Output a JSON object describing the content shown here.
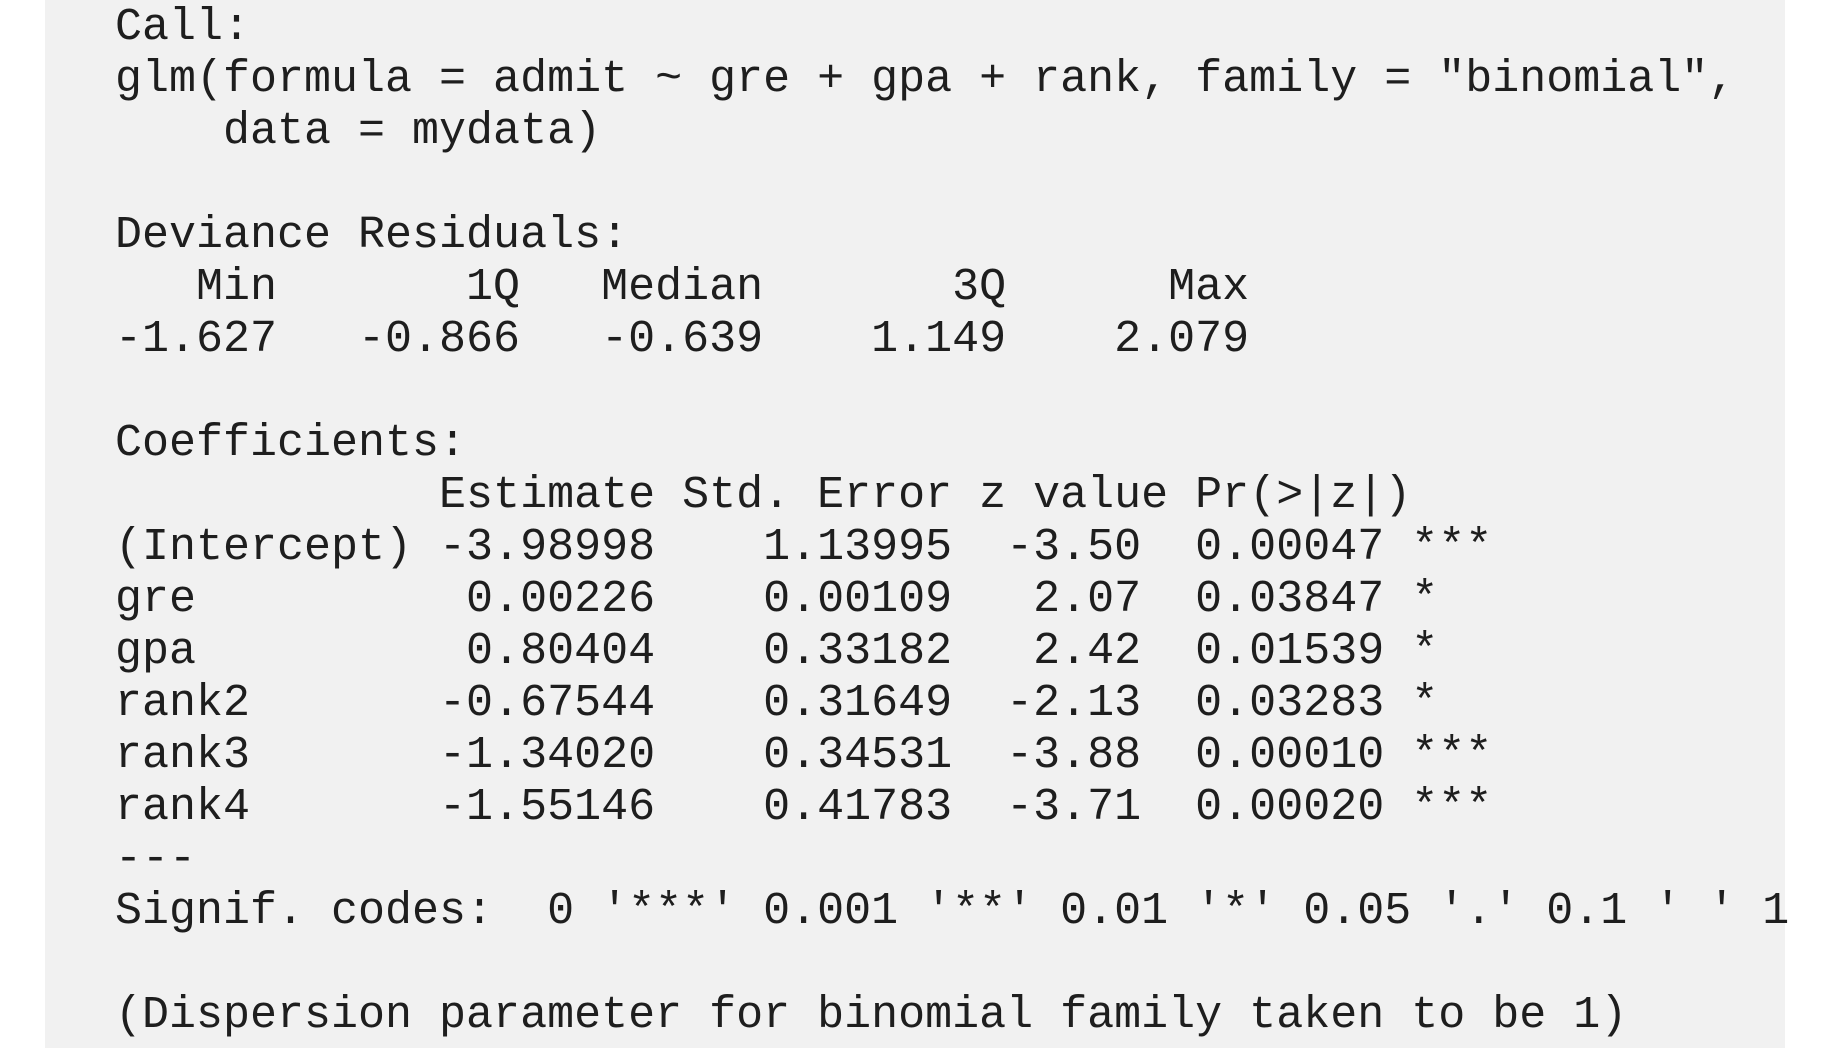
{
  "call": {
    "header": "Call:",
    "line1": "glm(formula = admit ~ gre + gpa + rank, family = \"binomial\",",
    "line2": "    data = mydata)"
  },
  "deviance_residuals": {
    "header": "Deviance Residuals:",
    "labels_line": "   Min       1Q   Median       3Q      Max  ",
    "values_line": "-1.627   -0.866   -0.639    1.149    2.079  ",
    "labels": [
      "Min",
      "1Q",
      "Median",
      "3Q",
      "Max"
    ],
    "values": [
      "-1.627",
      "-0.866",
      "-0.639",
      "1.149",
      "2.079"
    ]
  },
  "coefficients": {
    "header": "Coefficients:",
    "column_header_line": "            Estimate Std. Error z value Pr(>|z|)    ",
    "columns": [
      "Estimate",
      "Std. Error",
      "z value",
      "Pr(>|z|)"
    ],
    "rows": [
      {
        "line": "(Intercept) -3.98998    1.13995  -3.50  0.00047 ***",
        "name": "(Intercept)",
        "estimate": "-3.98998",
        "std_error": "1.13995",
        "z_value": "-3.50",
        "p_value": "0.00047",
        "signif": "***"
      },
      {
        "line": "gre          0.00226    0.00109   2.07  0.03847 *  ",
        "name": "gre",
        "estimate": "0.00226",
        "std_error": "0.00109",
        "z_value": "2.07",
        "p_value": "0.03847",
        "signif": "*"
      },
      {
        "line": "gpa          0.80404    0.33182   2.42  0.01539 *  ",
        "name": "gpa",
        "estimate": "0.80404",
        "std_error": "0.33182",
        "z_value": "2.42",
        "p_value": "0.01539",
        "signif": "*"
      },
      {
        "line": "rank2       -0.67544    0.31649  -2.13  0.03283 *  ",
        "name": "rank2",
        "estimate": "-0.67544",
        "std_error": "0.31649",
        "z_value": "-2.13",
        "p_value": "0.03283",
        "signif": "*"
      },
      {
        "line": "rank3       -1.34020    0.34531  -3.88  0.00010 ***",
        "name": "rank3",
        "estimate": "-1.34020",
        "std_error": "0.34531",
        "z_value": "-3.88",
        "p_value": "0.00010",
        "signif": "***"
      },
      {
        "line": "rank4       -1.55146    0.41783  -3.71  0.00020 ***",
        "name": "rank4",
        "estimate": "-1.55146",
        "std_error": "0.41783",
        "z_value": "-3.71",
        "p_value": "0.00020",
        "signif": "***"
      }
    ]
  },
  "separator": "---",
  "signif_codes": "Signif. codes:  0 '***' 0.001 '**' 0.01 '*' 0.05 '.' 0.1 ' ' 1",
  "dispersion_note": "(Dispersion parameter for binomial family taken to be 1)",
  "colors": {
    "background": "#f1f1f1",
    "text": "#1e1e1e"
  }
}
